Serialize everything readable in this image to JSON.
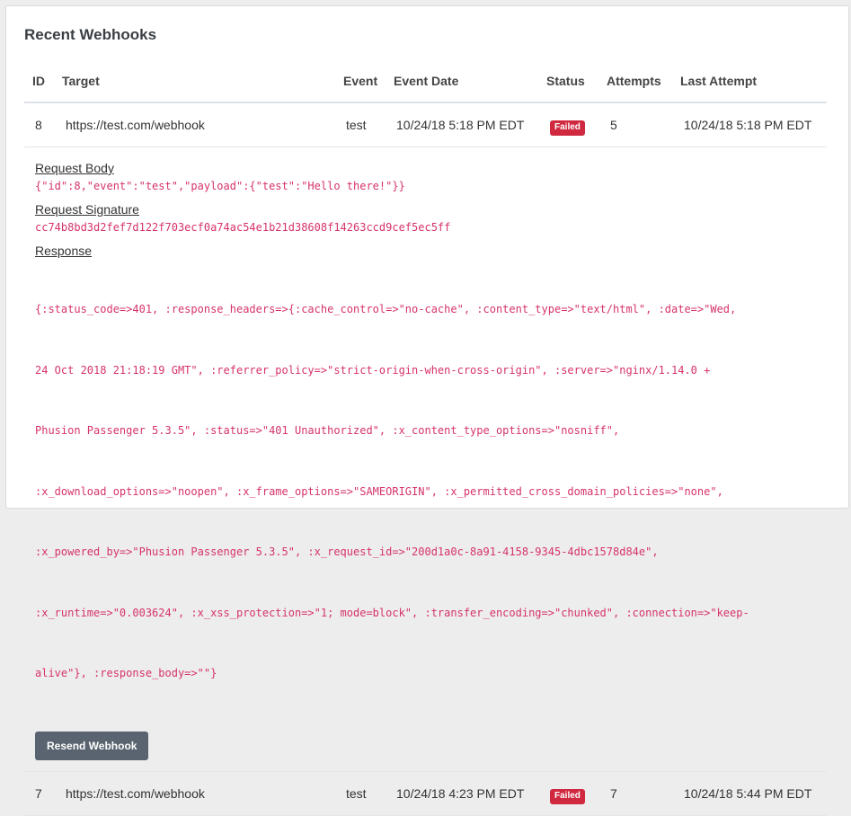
{
  "card": {
    "title": "Recent Webhooks"
  },
  "columns": {
    "id": "ID",
    "target": "Target",
    "event": "Event",
    "event_date": "Event Date",
    "status": "Status",
    "attempts": "Attempts",
    "last_attempt": "Last Attempt"
  },
  "rows": [
    {
      "id": "8",
      "target": "https://test.com/webhook",
      "event": "test",
      "event_date": "10/24/18 5:18 PM EDT",
      "status": "Failed",
      "attempts": "5",
      "last_attempt": "10/24/18 5:18 PM EDT"
    },
    {
      "id": "7",
      "target": "https://test.com/webhook",
      "event": "test",
      "event_date": "10/24/18 4:23 PM EDT",
      "status": "Failed",
      "attempts": "7",
      "last_attempt": "10/24/18 5:44 PM EDT"
    }
  ],
  "details": {
    "request_body_label": "Request Body",
    "request_body": "{\"id\":8,\"event\":\"test\",\"payload\":{\"test\":\"Hello there!\"}}",
    "request_signature_label": "Request Signature",
    "request_signature": "cc74b8bd3d2fef7d122f703ecf0a74ac54e1b21d38608f14263ccd9cef5ec5ff",
    "response_label": "Response",
    "response_lines": [
      "{:status_code=>401, :response_headers=>{:cache_control=>\"no-cache\", :content_type=>\"text/html\", :date=>\"Wed,",
      "24 Oct 2018 21:18:19 GMT\", :referrer_policy=>\"strict-origin-when-cross-origin\", :server=>\"nginx/1.14.0 +",
      "Phusion Passenger 5.3.5\", :status=>\"401 Unauthorized\", :x_content_type_options=>\"nosniff\",",
      ":x_download_options=>\"noopen\", :x_frame_options=>\"SAMEORIGIN\", :x_permitted_cross_domain_policies=>\"none\",",
      ":x_powered_by=>\"Phusion Passenger 5.3.5\", :x_request_id=>\"200d1a0c-8a91-4158-9345-4dbc1578d84e\",",
      ":x_runtime=>\"0.003624\", :x_xss_protection=>\"1; mode=block\", :transfer_encoding=>\"chunked\", :connection=>\"keep-",
      "alive\"}, :response_body=>\"\"}"
    ],
    "resend_label": "Resend Webhook"
  },
  "colors": {
    "failed_badge": "#d0283f",
    "code_text": "#d6336c",
    "resend_button": "#5a6470"
  }
}
